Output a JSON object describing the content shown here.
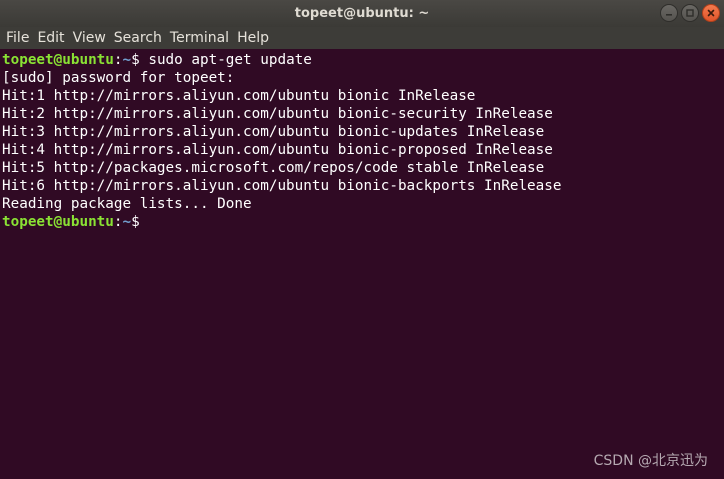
{
  "window": {
    "title": "topeet@ubuntu: ~"
  },
  "menu": {
    "items": [
      "File",
      "Edit",
      "View",
      "Search",
      "Terminal",
      "Help"
    ]
  },
  "terminal": {
    "prompt_user": "topeet@ubuntu",
    "prompt_sep": ":",
    "prompt_path": "~",
    "prompt_symbol": "$ ",
    "command": "sudo apt-get update",
    "output": [
      "[sudo] password for topeet:",
      "Hit:1 http://mirrors.aliyun.com/ubuntu bionic InRelease",
      "Hit:2 http://mirrors.aliyun.com/ubuntu bionic-security InRelease",
      "Hit:3 http://mirrors.aliyun.com/ubuntu bionic-updates InRelease",
      "Hit:4 http://mirrors.aliyun.com/ubuntu bionic-proposed InRelease",
      "Hit:5 http://packages.microsoft.com/repos/code stable InRelease",
      "Hit:6 http://mirrors.aliyun.com/ubuntu bionic-backports InRelease",
      "Reading package lists... Done"
    ],
    "final_prompt_symbol": "$"
  },
  "watermark": "CSDN @北京迅为",
  "colors": {
    "background": "#300a24",
    "prompt_user": "#8ae234",
    "prompt_path": "#729fcf",
    "text": "#ffffff"
  }
}
